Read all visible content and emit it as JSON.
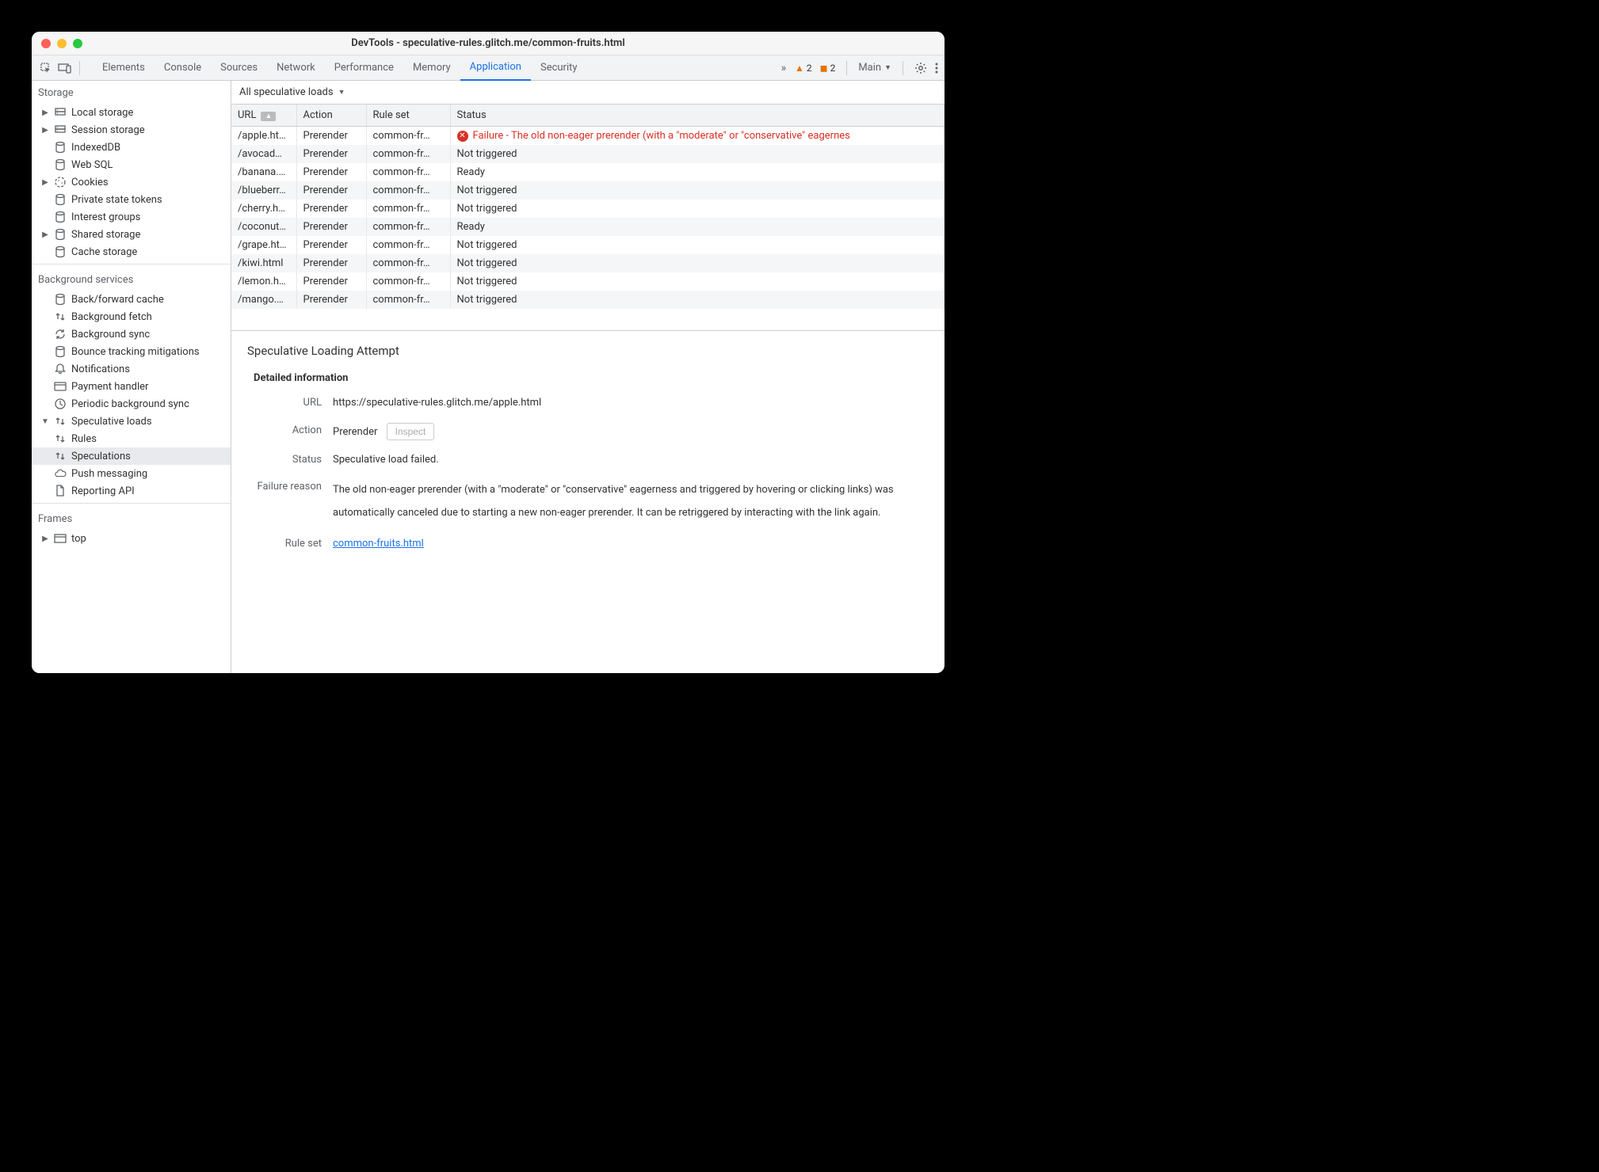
{
  "window": {
    "title": "DevTools - speculative-rules.glitch.me/common-fruits.html"
  },
  "toolbar": {
    "tabs": [
      "Elements",
      "Console",
      "Sources",
      "Network",
      "Performance",
      "Memory",
      "Application",
      "Security"
    ],
    "active_tab": "Application",
    "warn1_count": "2",
    "warn2_count": "2",
    "main_label": "Main"
  },
  "sidebar": {
    "storage_title": "Storage",
    "storage_items": [
      {
        "label": "Local storage",
        "icon": "db",
        "expand": true
      },
      {
        "label": "Session storage",
        "icon": "db",
        "expand": true
      },
      {
        "label": "IndexedDB",
        "icon": "cylinder",
        "expand": false
      },
      {
        "label": "Web SQL",
        "icon": "cylinder",
        "expand": false
      },
      {
        "label": "Cookies",
        "icon": "cookie",
        "expand": true
      },
      {
        "label": "Private state tokens",
        "icon": "cylinder",
        "expand": false
      },
      {
        "label": "Interest groups",
        "icon": "cylinder",
        "expand": false
      },
      {
        "label": "Shared storage",
        "icon": "cylinder",
        "expand": true
      },
      {
        "label": "Cache storage",
        "icon": "cylinder",
        "expand": false
      }
    ],
    "bg_title": "Background services",
    "bg_items": [
      {
        "label": "Back/forward cache",
        "icon": "cylinder"
      },
      {
        "label": "Background fetch",
        "icon": "updown"
      },
      {
        "label": "Background sync",
        "icon": "sync"
      },
      {
        "label": "Bounce tracking mitigations",
        "icon": "cylinder"
      },
      {
        "label": "Notifications",
        "icon": "bell"
      },
      {
        "label": "Payment handler",
        "icon": "card"
      },
      {
        "label": "Periodic background sync",
        "icon": "clock"
      },
      {
        "label": "Speculative loads",
        "icon": "updown",
        "expand": "down"
      },
      {
        "label": "Rules",
        "icon": "updown",
        "child": true
      },
      {
        "label": "Speculations",
        "icon": "updown",
        "child": true,
        "selected": true
      },
      {
        "label": "Push messaging",
        "icon": "cloud"
      },
      {
        "label": "Reporting API",
        "icon": "file"
      }
    ],
    "frames_title": "Frames",
    "frames_items": [
      {
        "label": "top",
        "icon": "window",
        "expand": true
      }
    ]
  },
  "filter": {
    "label": "All speculative loads"
  },
  "table": {
    "headers": [
      "URL",
      "Action",
      "Rule set",
      "Status"
    ],
    "rows": [
      {
        "url": "/apple.html",
        "action": "Prerender",
        "ruleset": "common-fr…",
        "status": "Failure - The old non-eager prerender (with a \"moderate\" or \"conservative\" eagernes",
        "error": true
      },
      {
        "url": "/avocad…",
        "action": "Prerender",
        "ruleset": "common-fr…",
        "status": "Not triggered"
      },
      {
        "url": "/banana.…",
        "action": "Prerender",
        "ruleset": "common-fr…",
        "status": "Ready"
      },
      {
        "url": "/blueberr…",
        "action": "Prerender",
        "ruleset": "common-fr…",
        "status": "Not triggered"
      },
      {
        "url": "/cherry.h…",
        "action": "Prerender",
        "ruleset": "common-fr…",
        "status": "Not triggered"
      },
      {
        "url": "/coconut…",
        "action": "Prerender",
        "ruleset": "common-fr…",
        "status": "Ready"
      },
      {
        "url": "/grape.html",
        "action": "Prerender",
        "ruleset": "common-fr…",
        "status": "Not triggered"
      },
      {
        "url": "/kiwi.html",
        "action": "Prerender",
        "ruleset": "common-fr…",
        "status": "Not triggered"
      },
      {
        "url": "/lemon.h…",
        "action": "Prerender",
        "ruleset": "common-fr…",
        "status": "Not triggered"
      },
      {
        "url": "/mango.…",
        "action": "Prerender",
        "ruleset": "common-fr…",
        "status": "Not triggered"
      }
    ]
  },
  "details": {
    "title": "Speculative Loading Attempt",
    "subtitle": "Detailed information",
    "url_label": "URL",
    "url_value": "https://speculative-rules.glitch.me/apple.html",
    "action_label": "Action",
    "action_value": "Prerender",
    "inspect_label": "Inspect",
    "status_label": "Status",
    "status_value": "Speculative load failed.",
    "failure_label": "Failure reason",
    "failure_value": "The old non-eager prerender (with a \"moderate\" or \"conservative\" eagerness and triggered by hovering or clicking links) was automatically canceled due to starting a new non-eager prerender. It can be retriggered by interacting with the link again.",
    "ruleset_label": "Rule set",
    "ruleset_value": "common-fruits.html"
  }
}
